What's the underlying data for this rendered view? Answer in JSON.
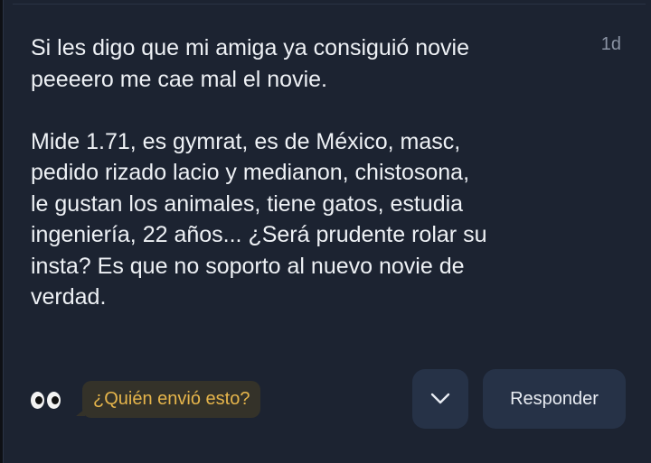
{
  "post": {
    "message": "Si les digo que mi amiga ya consiguió novie\npeeeero me cae mal el novie.\n\nMide 1.71, es gymrat, es de México, masc,\npedido rizado lacio y medianon, chistosona,\nle gustan los animales, tiene gatos, estudia\ningeniería, 22 años... ¿Será prudente rolar su\ninsta? Es que no soporto al nuevo novie de\nverdad.",
    "time": "1d"
  },
  "footer": {
    "reaction_icon": "eyes-icon",
    "who_sent_label": "¿Quién envió esto?",
    "chevron_icon": "chevron-down-icon",
    "reply_label": "Responder"
  },
  "colors": {
    "background": "#1c2331",
    "text": "#eef1f5",
    "accent": "#e6b54b",
    "button": "#263247"
  }
}
